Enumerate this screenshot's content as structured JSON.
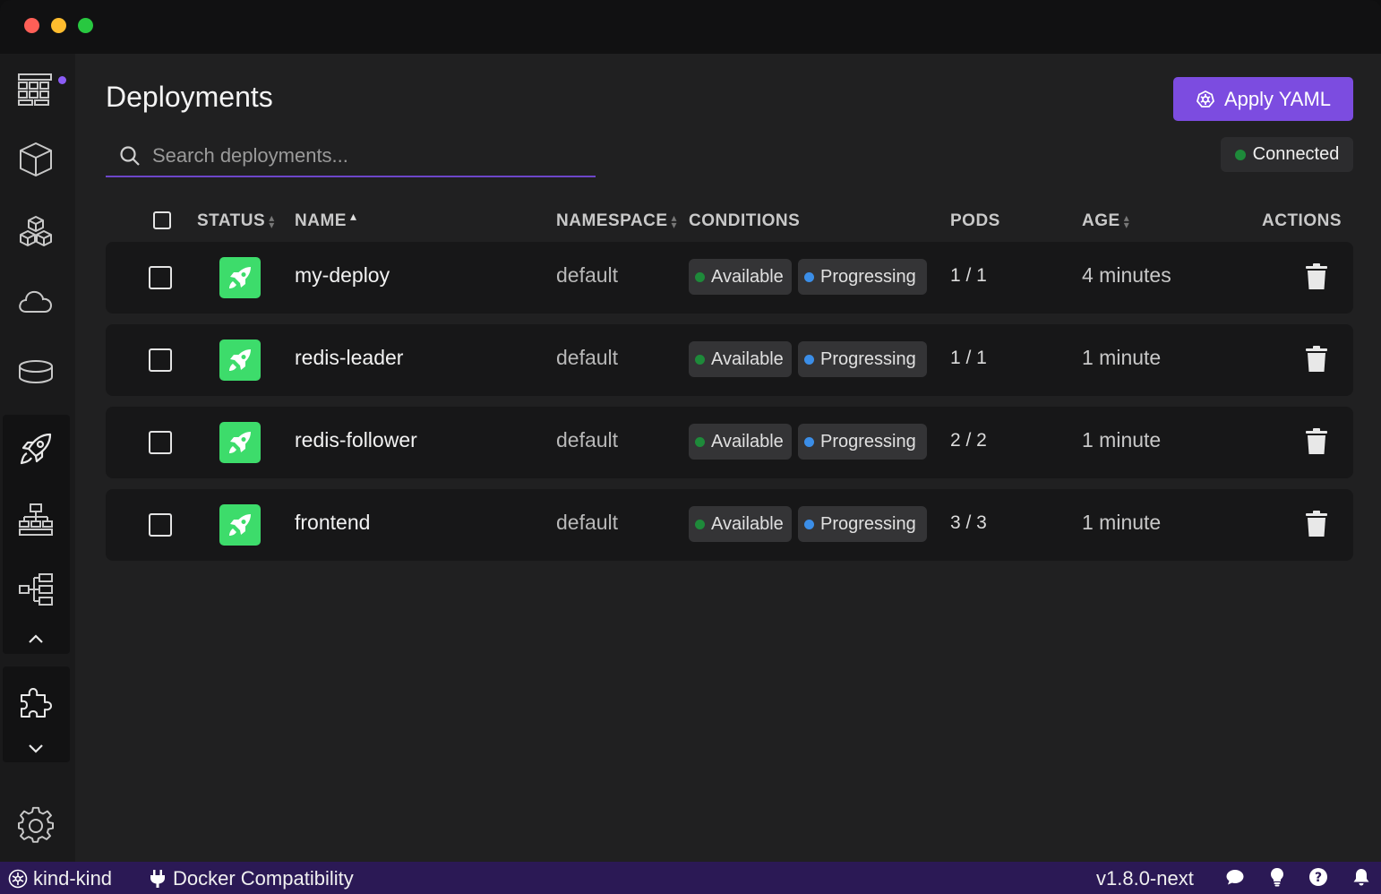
{
  "window": {
    "traffic_lights": [
      "close",
      "minimize",
      "maximize"
    ]
  },
  "sidebar": {
    "items": [
      {
        "icon": "dashboard-grid-icon",
        "badge": true
      },
      {
        "icon": "cube-icon"
      },
      {
        "icon": "cubes-icon"
      },
      {
        "icon": "cloud-icon"
      },
      {
        "icon": "database-icon"
      },
      {
        "icon": "rocket-icon",
        "active": true
      },
      {
        "icon": "network-topology-icon"
      },
      {
        "icon": "tree-hierarchy-icon"
      },
      {
        "icon": "puzzle-icon"
      },
      {
        "icon": "gear-icon"
      }
    ],
    "badge_color": "#8b5cf6"
  },
  "header": {
    "title": "Deployments",
    "apply_button_label": "Apply YAML",
    "search_placeholder": "Search deployments...",
    "connection_status": "Connected"
  },
  "table": {
    "columns": {
      "status": "STATUS",
      "name": "NAME",
      "namespace": "NAMESPACE",
      "conditions": "CONDITIONS",
      "pods": "PODS",
      "age": "AGE",
      "actions": "ACTIONS"
    },
    "rows": [
      {
        "name": "my-deploy",
        "namespace": "default",
        "condition_1": "Available",
        "condition_2": "Progressing",
        "pods": "1 / 1",
        "age": "4 minutes"
      },
      {
        "name": "redis-leader",
        "namespace": "default",
        "condition_1": "Available",
        "condition_2": "Progressing",
        "pods": "1 / 1",
        "age": "1 minute"
      },
      {
        "name": "redis-follower",
        "namespace": "default",
        "condition_1": "Available",
        "condition_2": "Progressing",
        "pods": "2 / 2",
        "age": "1 minute"
      },
      {
        "name": "frontend",
        "namespace": "default",
        "condition_1": "Available",
        "condition_2": "Progressing",
        "pods": "3 / 3",
        "age": "1 minute"
      }
    ]
  },
  "statusbar": {
    "context": "kind-kind",
    "docker_compat": "Docker Compatibility",
    "version": "v1.8.0-next"
  },
  "colors": {
    "accent": "#7c4ce0",
    "status_ok": "#3ddc6b",
    "available_dot": "#1e8a3a",
    "progressing_dot": "#3b8ee8",
    "statusbar_bg": "#2b1955"
  }
}
